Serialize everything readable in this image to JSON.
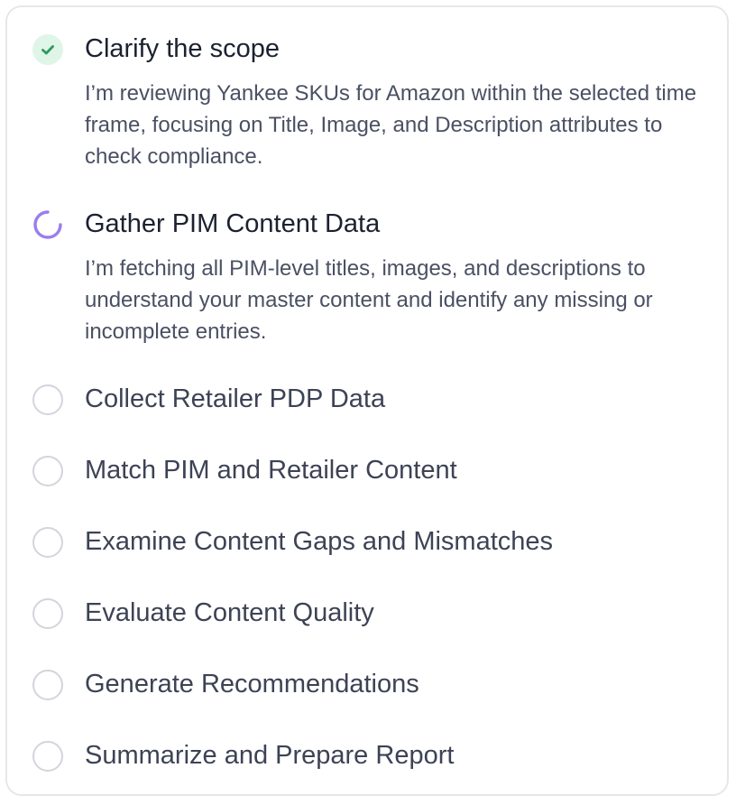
{
  "colors": {
    "done_bg": "#dff5e8",
    "done_check": "#2f9a5a",
    "progress_arc": "#9b7ded",
    "pending_ring": "#d3d5dc",
    "border": "#e6e7eb"
  },
  "steps": [
    {
      "title": "Clarify the scope",
      "status": "done",
      "icon": "check-icon",
      "description": "I’m reviewing Yankee SKUs for Amazon within the selected time frame, focusing on Title, Image, and Description attributes to check compliance."
    },
    {
      "title": "Gather PIM Content Data",
      "status": "in-progress",
      "icon": "spinner-icon",
      "description": "I’m fetching all PIM-level titles, images, and descriptions to understand your master content and identify any missing or incomplete entries."
    },
    {
      "title": "Collect Retailer PDP Data",
      "status": "pending",
      "icon": "empty-circle-icon"
    },
    {
      "title": "Match PIM and Retailer Content",
      "status": "pending",
      "icon": "empty-circle-icon"
    },
    {
      "title": "Examine Content Gaps and Mismatches",
      "status": "pending",
      "icon": "empty-circle-icon"
    },
    {
      "title": "Evaluate Content Quality",
      "status": "pending",
      "icon": "empty-circle-icon"
    },
    {
      "title": "Generate Recommendations",
      "status": "pending",
      "icon": "empty-circle-icon"
    },
    {
      "title": "Summarize and Prepare Report",
      "status": "pending",
      "icon": "empty-circle-icon"
    }
  ]
}
